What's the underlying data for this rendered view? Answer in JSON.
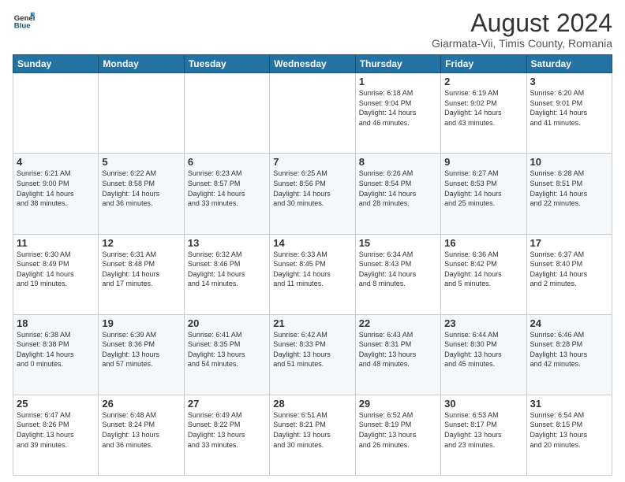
{
  "logo": {
    "general": "General",
    "blue": "Blue"
  },
  "title": "August 2024",
  "subtitle": "Giarmata-Vii, Timis County, Romania",
  "days_of_week": [
    "Sunday",
    "Monday",
    "Tuesday",
    "Wednesday",
    "Thursday",
    "Friday",
    "Saturday"
  ],
  "weeks": [
    [
      {
        "day": "",
        "info": ""
      },
      {
        "day": "",
        "info": ""
      },
      {
        "day": "",
        "info": ""
      },
      {
        "day": "",
        "info": ""
      },
      {
        "day": "1",
        "info": "Sunrise: 6:18 AM\nSunset: 9:04 PM\nDaylight: 14 hours\nand 46 minutes."
      },
      {
        "day": "2",
        "info": "Sunrise: 6:19 AM\nSunset: 9:02 PM\nDaylight: 14 hours\nand 43 minutes."
      },
      {
        "day": "3",
        "info": "Sunrise: 6:20 AM\nSunset: 9:01 PM\nDaylight: 14 hours\nand 41 minutes."
      }
    ],
    [
      {
        "day": "4",
        "info": "Sunrise: 6:21 AM\nSunset: 9:00 PM\nDaylight: 14 hours\nand 38 minutes."
      },
      {
        "day": "5",
        "info": "Sunrise: 6:22 AM\nSunset: 8:58 PM\nDaylight: 14 hours\nand 36 minutes."
      },
      {
        "day": "6",
        "info": "Sunrise: 6:23 AM\nSunset: 8:57 PM\nDaylight: 14 hours\nand 33 minutes."
      },
      {
        "day": "7",
        "info": "Sunrise: 6:25 AM\nSunset: 8:56 PM\nDaylight: 14 hours\nand 30 minutes."
      },
      {
        "day": "8",
        "info": "Sunrise: 6:26 AM\nSunset: 8:54 PM\nDaylight: 14 hours\nand 28 minutes."
      },
      {
        "day": "9",
        "info": "Sunrise: 6:27 AM\nSunset: 8:53 PM\nDaylight: 14 hours\nand 25 minutes."
      },
      {
        "day": "10",
        "info": "Sunrise: 6:28 AM\nSunset: 8:51 PM\nDaylight: 14 hours\nand 22 minutes."
      }
    ],
    [
      {
        "day": "11",
        "info": "Sunrise: 6:30 AM\nSunset: 8:49 PM\nDaylight: 14 hours\nand 19 minutes."
      },
      {
        "day": "12",
        "info": "Sunrise: 6:31 AM\nSunset: 8:48 PM\nDaylight: 14 hours\nand 17 minutes."
      },
      {
        "day": "13",
        "info": "Sunrise: 6:32 AM\nSunset: 8:46 PM\nDaylight: 14 hours\nand 14 minutes."
      },
      {
        "day": "14",
        "info": "Sunrise: 6:33 AM\nSunset: 8:45 PM\nDaylight: 14 hours\nand 11 minutes."
      },
      {
        "day": "15",
        "info": "Sunrise: 6:34 AM\nSunset: 8:43 PM\nDaylight: 14 hours\nand 8 minutes."
      },
      {
        "day": "16",
        "info": "Sunrise: 6:36 AM\nSunset: 8:42 PM\nDaylight: 14 hours\nand 5 minutes."
      },
      {
        "day": "17",
        "info": "Sunrise: 6:37 AM\nSunset: 8:40 PM\nDaylight: 14 hours\nand 2 minutes."
      }
    ],
    [
      {
        "day": "18",
        "info": "Sunrise: 6:38 AM\nSunset: 8:38 PM\nDaylight: 14 hours\nand 0 minutes."
      },
      {
        "day": "19",
        "info": "Sunrise: 6:39 AM\nSunset: 8:36 PM\nDaylight: 13 hours\nand 57 minutes."
      },
      {
        "day": "20",
        "info": "Sunrise: 6:41 AM\nSunset: 8:35 PM\nDaylight: 13 hours\nand 54 minutes."
      },
      {
        "day": "21",
        "info": "Sunrise: 6:42 AM\nSunset: 8:33 PM\nDaylight: 13 hours\nand 51 minutes."
      },
      {
        "day": "22",
        "info": "Sunrise: 6:43 AM\nSunset: 8:31 PM\nDaylight: 13 hours\nand 48 minutes."
      },
      {
        "day": "23",
        "info": "Sunrise: 6:44 AM\nSunset: 8:30 PM\nDaylight: 13 hours\nand 45 minutes."
      },
      {
        "day": "24",
        "info": "Sunrise: 6:46 AM\nSunset: 8:28 PM\nDaylight: 13 hours\nand 42 minutes."
      }
    ],
    [
      {
        "day": "25",
        "info": "Sunrise: 6:47 AM\nSunset: 8:26 PM\nDaylight: 13 hours\nand 39 minutes."
      },
      {
        "day": "26",
        "info": "Sunrise: 6:48 AM\nSunset: 8:24 PM\nDaylight: 13 hours\nand 36 minutes."
      },
      {
        "day": "27",
        "info": "Sunrise: 6:49 AM\nSunset: 8:22 PM\nDaylight: 13 hours\nand 33 minutes."
      },
      {
        "day": "28",
        "info": "Sunrise: 6:51 AM\nSunset: 8:21 PM\nDaylight: 13 hours\nand 30 minutes."
      },
      {
        "day": "29",
        "info": "Sunrise: 6:52 AM\nSunset: 8:19 PM\nDaylight: 13 hours\nand 26 minutes."
      },
      {
        "day": "30",
        "info": "Sunrise: 6:53 AM\nSunset: 8:17 PM\nDaylight: 13 hours\nand 23 minutes."
      },
      {
        "day": "31",
        "info": "Sunrise: 6:54 AM\nSunset: 8:15 PM\nDaylight: 13 hours\nand 20 minutes."
      }
    ]
  ]
}
